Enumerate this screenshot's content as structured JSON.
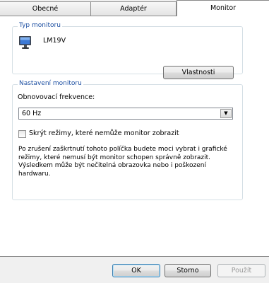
{
  "tabs": [
    {
      "label": "Obecné",
      "active": false
    },
    {
      "label": "Adaptér",
      "active": false
    },
    {
      "label": "Monitor",
      "active": true
    }
  ],
  "monitor_type": {
    "title": "Typ monitoru",
    "monitor_name": "LM19V",
    "properties_button": "Vlastnosti"
  },
  "monitor_settings": {
    "title": "Nastavení monitoru",
    "refresh_label": "Obnovovací frekvence:",
    "refresh_value": "60 Hz",
    "hide_modes_label": "Skrýt režimy, které nemůže monitor zobrazit",
    "hide_modes_checked": false,
    "note": "Po zrušení zaškrtnutí tohoto políčka budete moci vybrat i grafické režimy, které nemusí být monitor schopen správně zobrazit. Výsledkem může být nečitelná obrazovka nebo i poškození hardwaru."
  },
  "footer": {
    "ok": "OK",
    "cancel": "Storno",
    "apply": "Použít"
  },
  "colors": {
    "group_title": "#1e50a2",
    "background": "#f0f0f0"
  }
}
